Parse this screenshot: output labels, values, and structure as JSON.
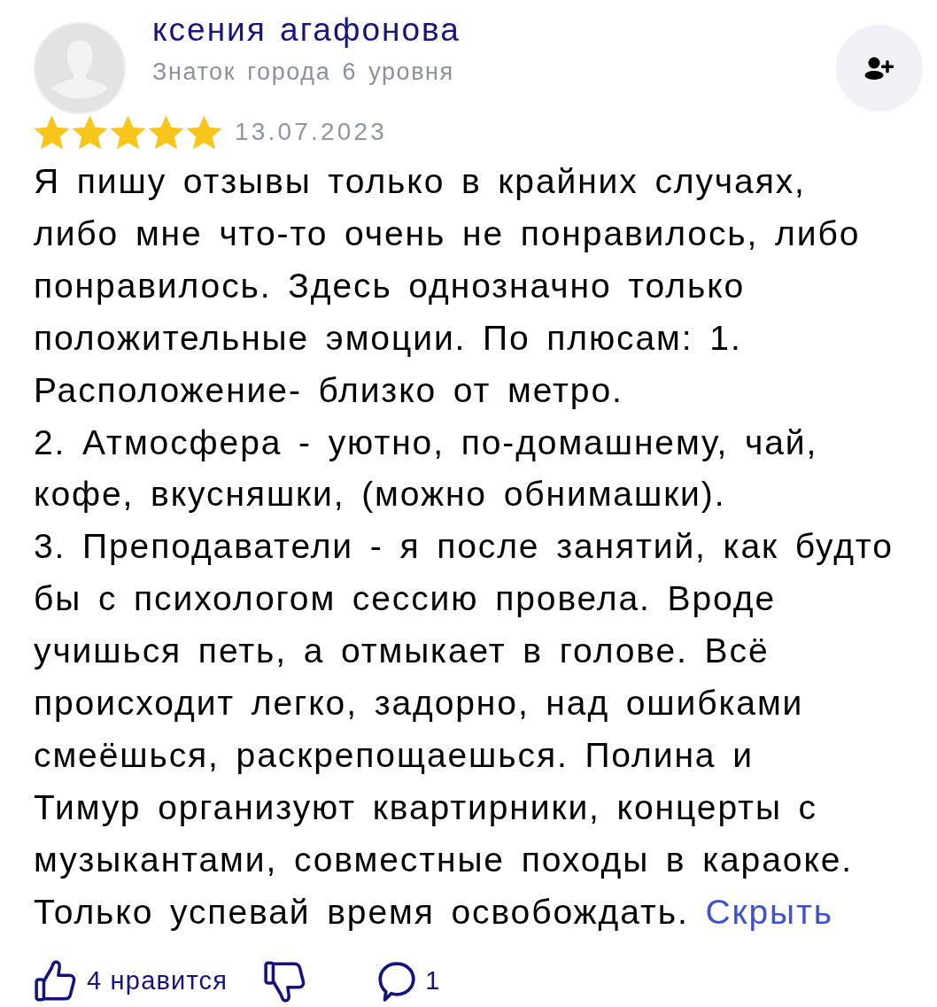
{
  "author": {
    "name": "ксения агафонова",
    "level": "Знаток города 6 уровня"
  },
  "review": {
    "stars": 5,
    "date": "13.07.2023",
    "text": "Я пишу отзывы только в крайних случаях,\nлибо мне что-то очень не понравилось, либо\nпонравилось. Здесь однозначно только\nположительные эмоции. По плюсам: 1.\nРасположение- близко от метро.\n2. Атмосфера - уютно, по-домашнему, чай,\nкофе, вкусняшки, (можно обнимашки).\n3. Преподаватели - я после занятий, как будто\nбы с психологом сессию провела. Вроде\nучишься петь, а отмыкает в голове. Всё\nпроисходит легко, задорно, над ошибками\nсмеёшься, раскрепощаешься. Полина и\nТимур организуют квартирники, концерты с\nмузыкантами, совместные походы в караоке.\nТолько успевай время освобождать.",
    "collapse_link": "Скрыть"
  },
  "actions": {
    "likes": "4 нравится",
    "comments": "1"
  }
}
